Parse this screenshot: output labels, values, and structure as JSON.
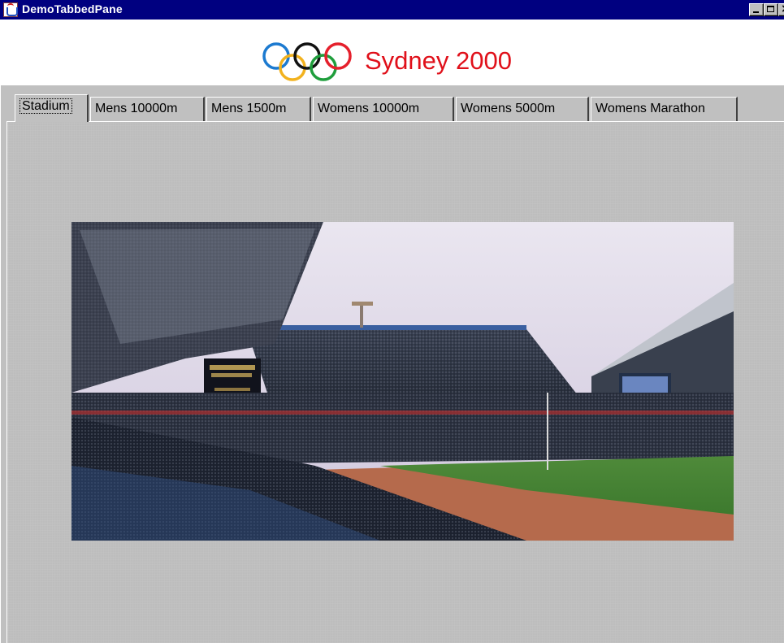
{
  "window": {
    "title": "DemoTabbedPane"
  },
  "header": {
    "brand": "Sydney 2000"
  },
  "tabs": [
    {
      "label": "Stadium",
      "active": true
    },
    {
      "label": "Mens 10000m",
      "active": false
    },
    {
      "label": "Mens 1500m",
      "active": false
    },
    {
      "label": "Womens 10000m",
      "active": false
    },
    {
      "label": "Womens 5000m",
      "active": false
    },
    {
      "label": "Womens Marathon",
      "active": false
    }
  ],
  "colors": {
    "titlebar": "#000080",
    "brand_text": "#e0101a",
    "ring_blue": "#1c7ad0",
    "ring_yellow": "#f2b21e",
    "ring_black": "#111111",
    "ring_green": "#1f9e3c",
    "ring_red": "#e5202c"
  },
  "content": {
    "image": "sydney-olympic-stadium-photo"
  }
}
